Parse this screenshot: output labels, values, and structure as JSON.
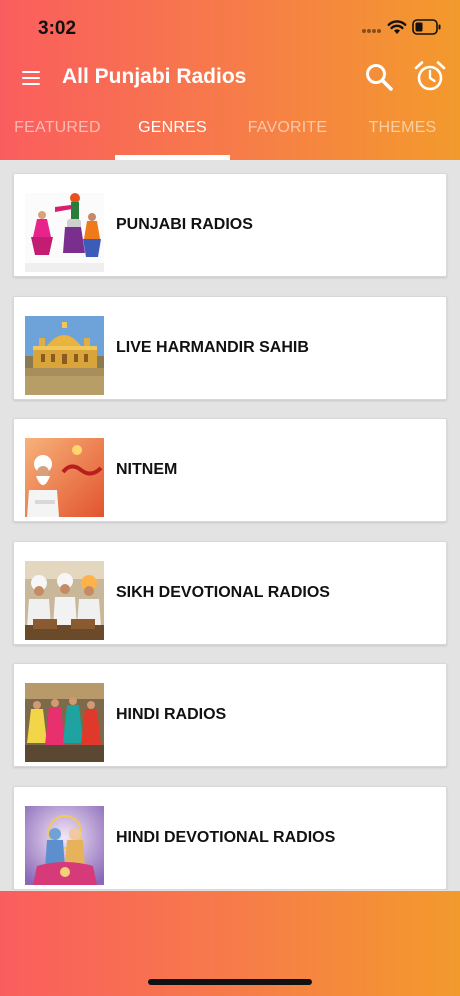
{
  "status_bar": {
    "time": "3:02"
  },
  "app_bar": {
    "title": "All Punjabi Radios",
    "icons": [
      "menu-icon",
      "search-icon",
      "alarm-clock-icon"
    ]
  },
  "tabs": [
    {
      "label": "FEATURED",
      "active": false
    },
    {
      "label": "GENRES",
      "active": true
    },
    {
      "label": "FAVORITE",
      "active": false
    },
    {
      "label": "THEMES",
      "active": false
    }
  ],
  "genres": [
    {
      "label": "PUNJABI RADIOS",
      "thumbnail": "bhangra-dancers-image"
    },
    {
      "label": "LIVE HARMANDIR SAHIB",
      "thumbnail": "golden-temple-image"
    },
    {
      "label": "NITNEM",
      "thumbnail": "nitnem-singer-image"
    },
    {
      "label": "SIKH DEVOTIONAL RADIOS",
      "thumbnail": "kirtan-singers-image"
    },
    {
      "label": "HINDI RADIOS",
      "thumbnail": "bollywood-dancers-image"
    },
    {
      "label": "HINDI DEVOTIONAL RADIOS",
      "thumbnail": "hindu-deities-image"
    }
  ],
  "colors": {
    "gradient_start": "#fa5d5e",
    "gradient_end": "#f39a2c",
    "list_background": "#e3e3e3",
    "card_background": "#ffffff"
  }
}
